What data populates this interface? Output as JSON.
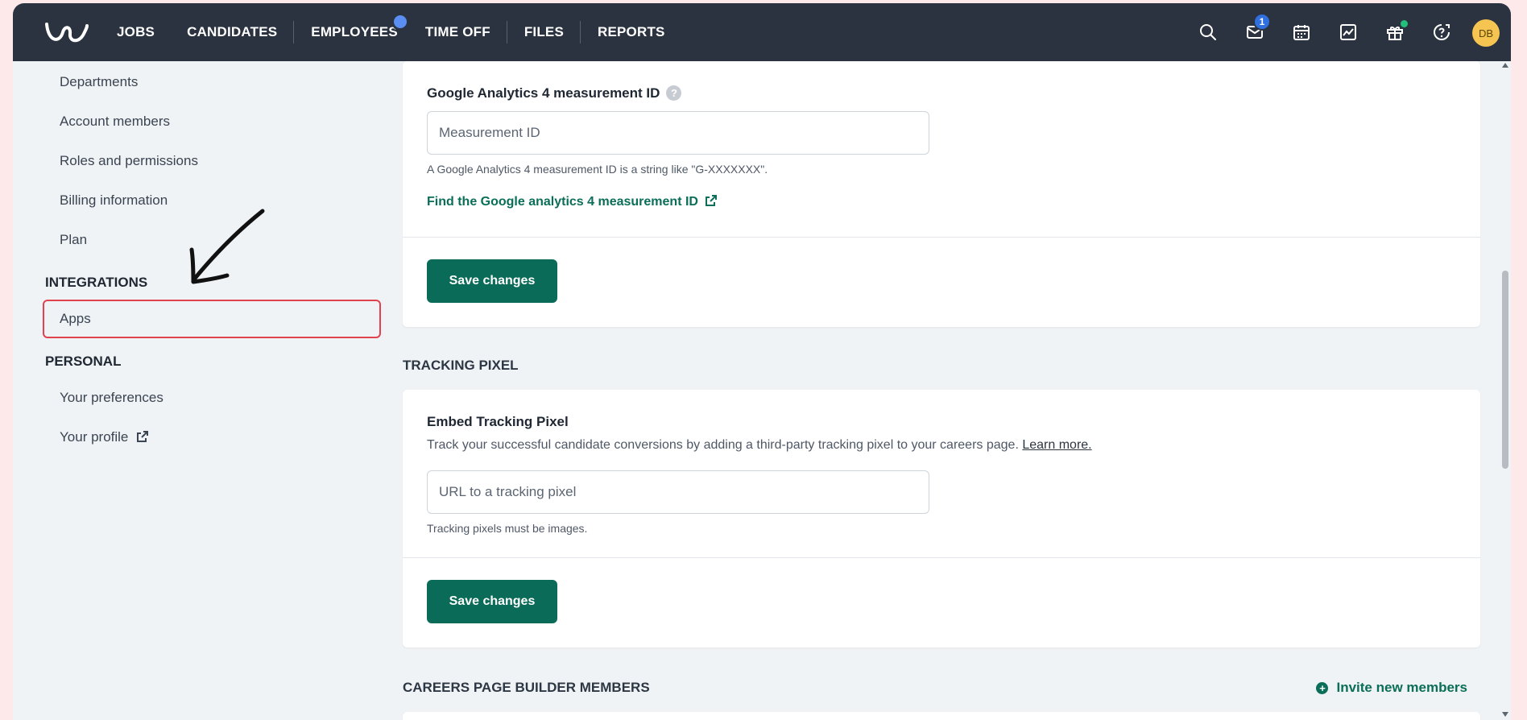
{
  "nav": {
    "items": [
      {
        "label": "JOBS"
      },
      {
        "label": "CANDIDATES"
      },
      {
        "label": "EMPLOYEES"
      },
      {
        "label": "TIME OFF"
      },
      {
        "label": "FILES"
      },
      {
        "label": "REPORTS"
      }
    ],
    "mail_badge": "1",
    "avatar_initials": "DB"
  },
  "sidebar": {
    "links_top": [
      "Departments",
      "Account members",
      "Roles and permissions",
      "Billing information",
      "Plan"
    ],
    "integrations_heading": "INTEGRATIONS",
    "integrations_apps": "Apps",
    "personal_heading": "PERSONAL",
    "personal_links": [
      "Your preferences",
      "Your profile"
    ]
  },
  "ga": {
    "label": "Google Analytics 4 measurement ID",
    "placeholder": "Measurement ID",
    "hint": "A Google Analytics 4 measurement ID is a string like \"G-XXXXXXX\".",
    "link": "Find the Google analytics 4 measurement ID",
    "save": "Save changes"
  },
  "tracking": {
    "section_title": "TRACKING PIXEL",
    "label": "Embed Tracking Pixel",
    "desc": "Track your successful candidate conversions by adding a third-party tracking pixel to your careers page.",
    "learn_more": "Learn more.",
    "placeholder": "URL to a tracking pixel",
    "hint": "Tracking pixels must be images.",
    "save": "Save changes"
  },
  "members": {
    "section_title": "CAREERS PAGE BUILDER MEMBERS",
    "invite": "Invite new members"
  },
  "colors": {
    "nav_bg": "#2b3340",
    "accent": "#0a6b58",
    "highlight": "#e0434f"
  }
}
